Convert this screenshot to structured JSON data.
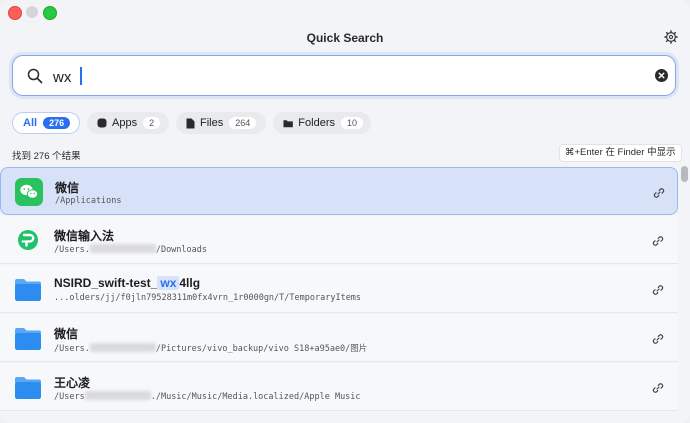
{
  "window": {
    "title": "Quick Search"
  },
  "search": {
    "value": "wx",
    "placeholder": ""
  },
  "tabs": [
    {
      "label": "All",
      "count": "276",
      "active": true
    },
    {
      "label": "Apps",
      "count": "2"
    },
    {
      "label": "Files",
      "count": "264"
    },
    {
      "label": "Folders",
      "count": "10"
    }
  ],
  "results_header": {
    "count_text": "找到 276 个结果",
    "hint": "⌘+Enter 在 Finder 中显示"
  },
  "results": [
    {
      "name": "微信",
      "path": "/Applications"
    },
    {
      "name": "微信输入法",
      "path_prefix": "/Users.",
      "path_suffix": "/Downloads"
    },
    {
      "name_prefix": "NSIRD_swift-test_",
      "name_highlight": "wx",
      "name_suffix": "4llg",
      "path": "...olders/jj/f0jln79528311m0fx4vrn_1r0000gn/T/TemporaryItems"
    },
    {
      "name": "微信",
      "path_prefix": "/Users.",
      "path_suffix": "/Pictures/vivo_backup/vivo S18+a95ae0/图片"
    },
    {
      "name": "王心凌",
      "path_prefix": "/Users",
      "path_suffix": "./Music/Music/Media.localized/Apple Music"
    }
  ],
  "colors": {
    "accent": "#2a6ff0",
    "wechat_green": "#2ac25e",
    "folder_blue": "#2d8cf0"
  }
}
